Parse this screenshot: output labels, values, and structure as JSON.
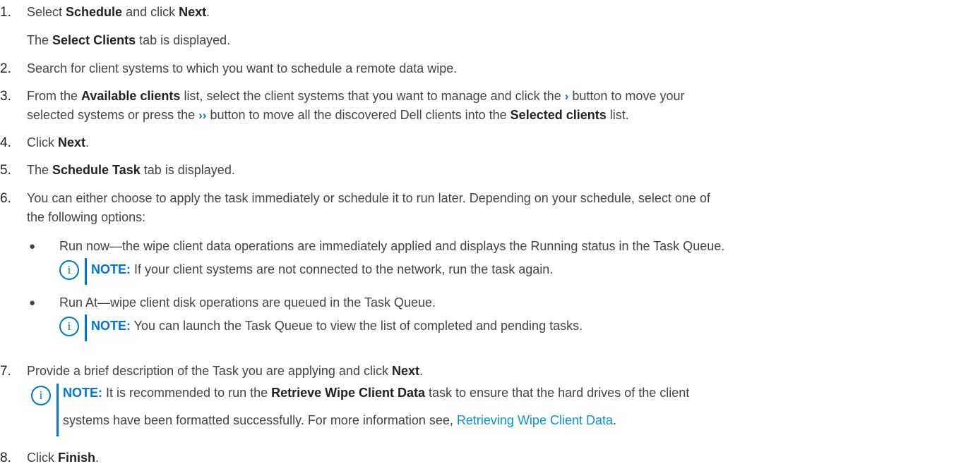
{
  "steps": [
    {
      "number": "1.",
      "text": [
        "Select ",
        "Schedule",
        " and click ",
        "Next",
        "."
      ],
      "sub": [
        "The ",
        "Select Clients",
        " tab is displayed."
      ]
    },
    {
      "number": "2.",
      "text": "Search for client systems to which you want to schedule a remote data wipe."
    },
    {
      "number": "3.",
      "line1": [
        "From the ",
        "Available clients",
        " list, select the client systems that you want to manage and click the ",
        "›",
        " button to move your"
      ],
      "line2": [
        "selected systems or press the ",
        "››",
        " button to move all the discovered Dell clients into the ",
        "Selected clients",
        " list."
      ]
    },
    {
      "number": "4.",
      "text": [
        "Click ",
        "Next",
        "."
      ]
    },
    {
      "number": "5.",
      "text": [
        "The ",
        "Schedule Task",
        " tab is displayed."
      ]
    },
    {
      "number": "6.",
      "line1": "You can either choose to apply the task immediately or schedule it to run later. Depending on your schedule, select one of",
      "line2": "the following options:",
      "bullets": [
        {
          "text": "Run now—the wipe client data operations are immediately applied and displays the Running status in the Task Queue.",
          "note_label": "NOTE:",
          "note_text": " If your client systems are not connected to the network, run the task again."
        },
        {
          "text": "Run At—wipe client disk operations are queued in the Task Queue.",
          "note_label": "NOTE:",
          "note_text": " You can launch the Task Queue to view the list of completed and pending tasks."
        }
      ]
    },
    {
      "number": "7.",
      "text": [
        "Provide a brief description of the Task you are applying and click ",
        "Next",
        "."
      ],
      "note_label": "NOTE:",
      "note_line1": [
        " It is recommended to run the ",
        "Retrieve Wipe Client Data",
        " task to ensure that the hard drives of the client"
      ],
      "note_line2_pre": "systems have been formatted successfully. For more information see, ",
      "note_link": "Retrieving Wipe Client Data",
      "note_line2_post": "."
    },
    {
      "number": "8.",
      "text": [
        "Click ",
        "Finish",
        "."
      ]
    }
  ],
  "bullet_glyph": "●",
  "note_icon_glyph": "i",
  "colors": {
    "accent": "#0076ce",
    "link": "#0e8fd8",
    "text": "#444444"
  }
}
